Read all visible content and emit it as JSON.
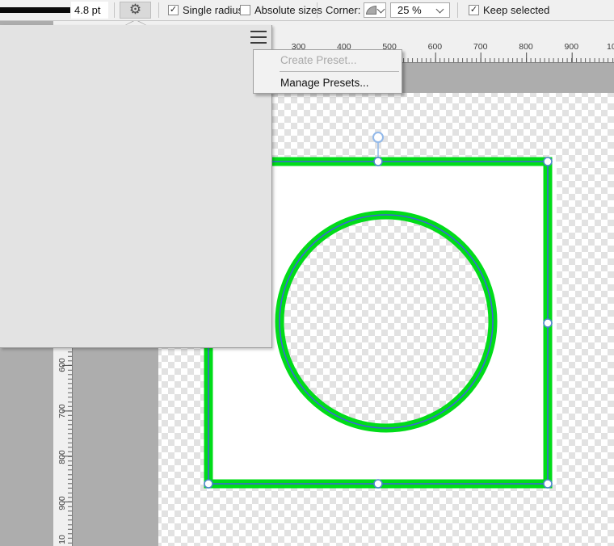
{
  "colors": {
    "accent_green": "#00dc19",
    "outline_blue": "#3c64dc",
    "handle_blue": "#4a86c8",
    "rotation_blue": "#92b9ea",
    "checker_dark": "#e2e2e2",
    "canvas_gray": "#adadad",
    "panel_bg": "#e3e3e3",
    "toolbar_bg": "#f0f0f0",
    "menu_bg": "#f2f2f2"
  },
  "icons": {
    "gear": "⚙",
    "checkmark": "✓"
  },
  "toolbar": {
    "stroke_width_value": "4.8 pt",
    "single_radius_label": "Single radius",
    "absolute_sizes_label": "Absolute sizes",
    "corner_label": "Corner:",
    "corner_percent_value": "25 %",
    "keep_selected_label": "Keep selected"
  },
  "context_menu": {
    "create_preset_label": "Create Preset...",
    "manage_presets_label": "Manage Presets..."
  },
  "ruler_top": {
    "labels": [
      "300",
      "400",
      "500",
      "600",
      "700",
      "800",
      "900",
      "10"
    ]
  },
  "ruler_left": {
    "labels": [
      "600",
      "700",
      "800",
      "900",
      "10"
    ]
  }
}
